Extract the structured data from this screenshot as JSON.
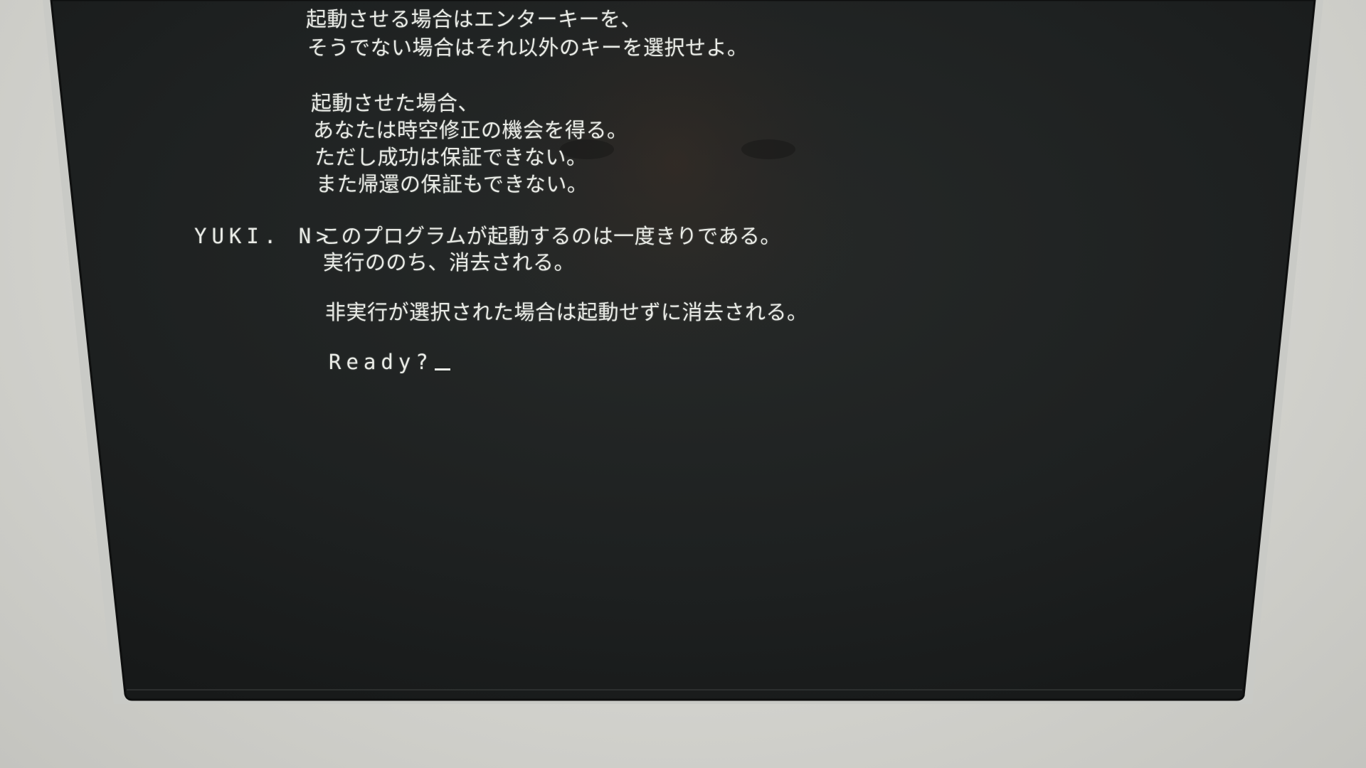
{
  "terminal": {
    "block1": [
      "起動させる場合はエンターキーを、",
      "そうでない場合はそれ以外のキーを選択せよ。"
    ],
    "block2": [
      "起動させた場合、",
      "あなたは時空修正の機会を得る。",
      "ただし成功は保証できない。",
      "また帰還の保証もできない。"
    ],
    "sender_prefix": "YUKI. N>",
    "block3": [
      "このプログラムが起動するのは一度きりである。",
      "実行ののち、消去される。"
    ],
    "block4": [
      "非実行が選択された場合は起動せずに消去される。"
    ],
    "prompt": "Ready?"
  },
  "colors": {
    "screen_background": "#1c1f1f",
    "text": "#e9ebe6",
    "bezel": "#cfd0cc"
  }
}
